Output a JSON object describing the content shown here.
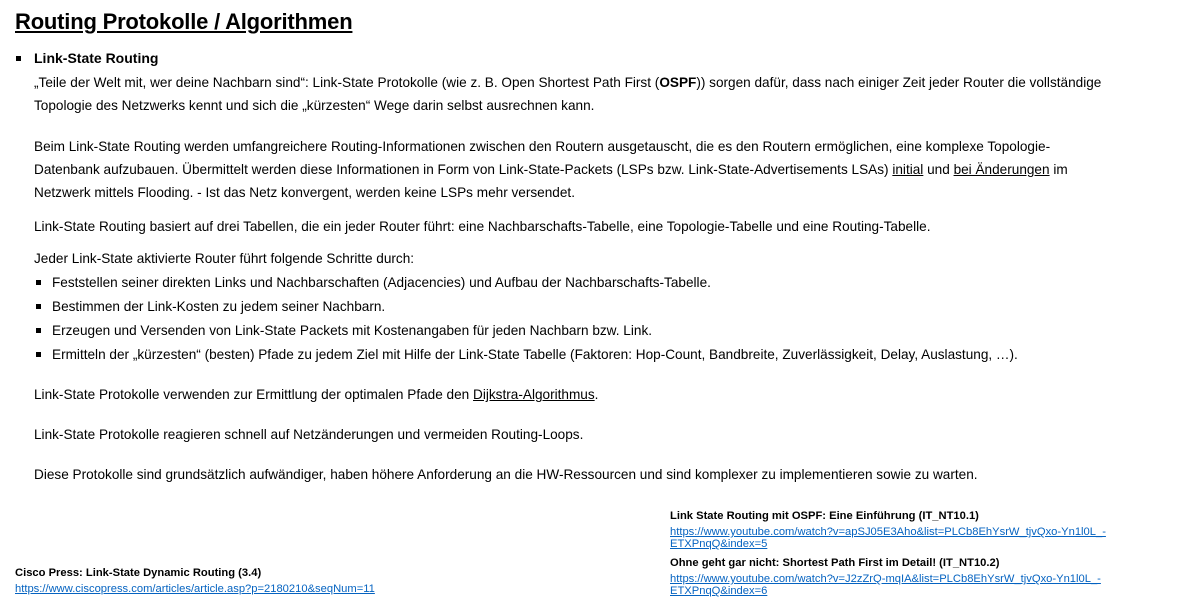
{
  "title": "Routing Protokolle / Algorithmen",
  "section": {
    "heading": "Link-State Routing",
    "intro_line1_a": "„Teile der Welt mit, wer deine Nachbarn sind“: Link-State Protokolle (wie z. B. Open Shortest Path First (",
    "intro_line1_bold": "OSPF",
    "intro_line1_b": ")) sorgen dafür, dass nach einiger Zeit jeder Router die vollständige",
    "intro_line2": "Topologie des Netzwerks kennt und sich die „kürzesten“ Wege darin selbst ausrechnen kann.",
    "p2_line1": "Beim Link-State Routing werden umfangreichere Routing-Informationen zwischen den Routern ausgetauscht, die es den Routern ermöglichen, eine komplexe Topologie-",
    "p2_line2_a": "Datenbank aufzubauen. Übermittelt werden diese Informationen in Form von Link-State-Packets (LSPs bzw. Link-State-Advertisements LSAs) ",
    "p2_line2_u1": "initial",
    "p2_line2_mid": " und ",
    "p2_line2_u2": "bei Änderungen",
    "p2_line2_b": " im",
    "p2_line3": "Netzwerk mittels Flooding. - Ist das Netz konvergent, werden keine LSPs mehr versendet.",
    "p3": "Link-State Routing basiert auf drei Tabellen, die ein jeder Router führt: eine Nachbarschafts-Tabelle, eine Topologie-Tabelle und eine Routing-Tabelle.",
    "p4": "Jeder Link-State aktivierte Router führt folgende Schritte durch:",
    "steps": [
      "Feststellen seiner direkten Links und Nachbarschaften (Adjacencies) und Aufbau der Nachbarschafts-Tabelle.",
      "Bestimmen der Link-Kosten zu jedem seiner Nachbarn.",
      "Erzeugen und Versenden von Link-State Packets mit Kostenangaben für jeden Nachbarn bzw. Link.",
      "Ermitteln der „kürzesten“ (besten) Pfade zu jedem Ziel mit Hilfe der Link-State Tabelle (Faktoren: Hop-Count, Bandbreite, Zuverlässigkeit, Delay, Auslastung, …)."
    ],
    "p5_a": "Link-State Protokolle verwenden zur Ermittlung der optimalen Pfade den ",
    "p5_link": "Dijkstra-Algorithmus",
    "p5_b": ".",
    "p6": "Link-State Protokolle reagieren schnell auf Netzänderungen und vermeiden Routing-Loops.",
    "p7": "Diese Protokolle sind grundsätzlich aufwändiger, haben höhere Anforderung an die HW-Ressourcen und sind komplexer zu implementieren sowie zu warten."
  },
  "references": {
    "left": {
      "title": "Cisco Press: Link-State Dynamic Routing (3.4)",
      "url": "https://www.ciscopress.com/articles/article.asp?p=2180210&seqNum=11"
    },
    "right": [
      {
        "title": "Link State Routing mit OSPF: Eine Einführung (IT_NT10.1)",
        "url_line1": "https://www.youtube.com/watch?v=apSJ05E3Aho&list=PLCb8EhYsrW_tjvQxo-Yn1l0L_-",
        "url_line2": "ETXPnqQ&index=5"
      },
      {
        "title": "Ohne geht gar nicht: Shortest Path First im Detail! (IT_NT10.2)",
        "url_line1": "https://www.youtube.com/watch?v=J2zZrQ-mqIA&list=PLCb8EhYsrW_tjvQxo-Yn1l0L_-",
        "url_line2": "ETXPnqQ&index=6"
      }
    ]
  },
  "colors": {
    "link": "#0563c1",
    "text": "#000000"
  }
}
